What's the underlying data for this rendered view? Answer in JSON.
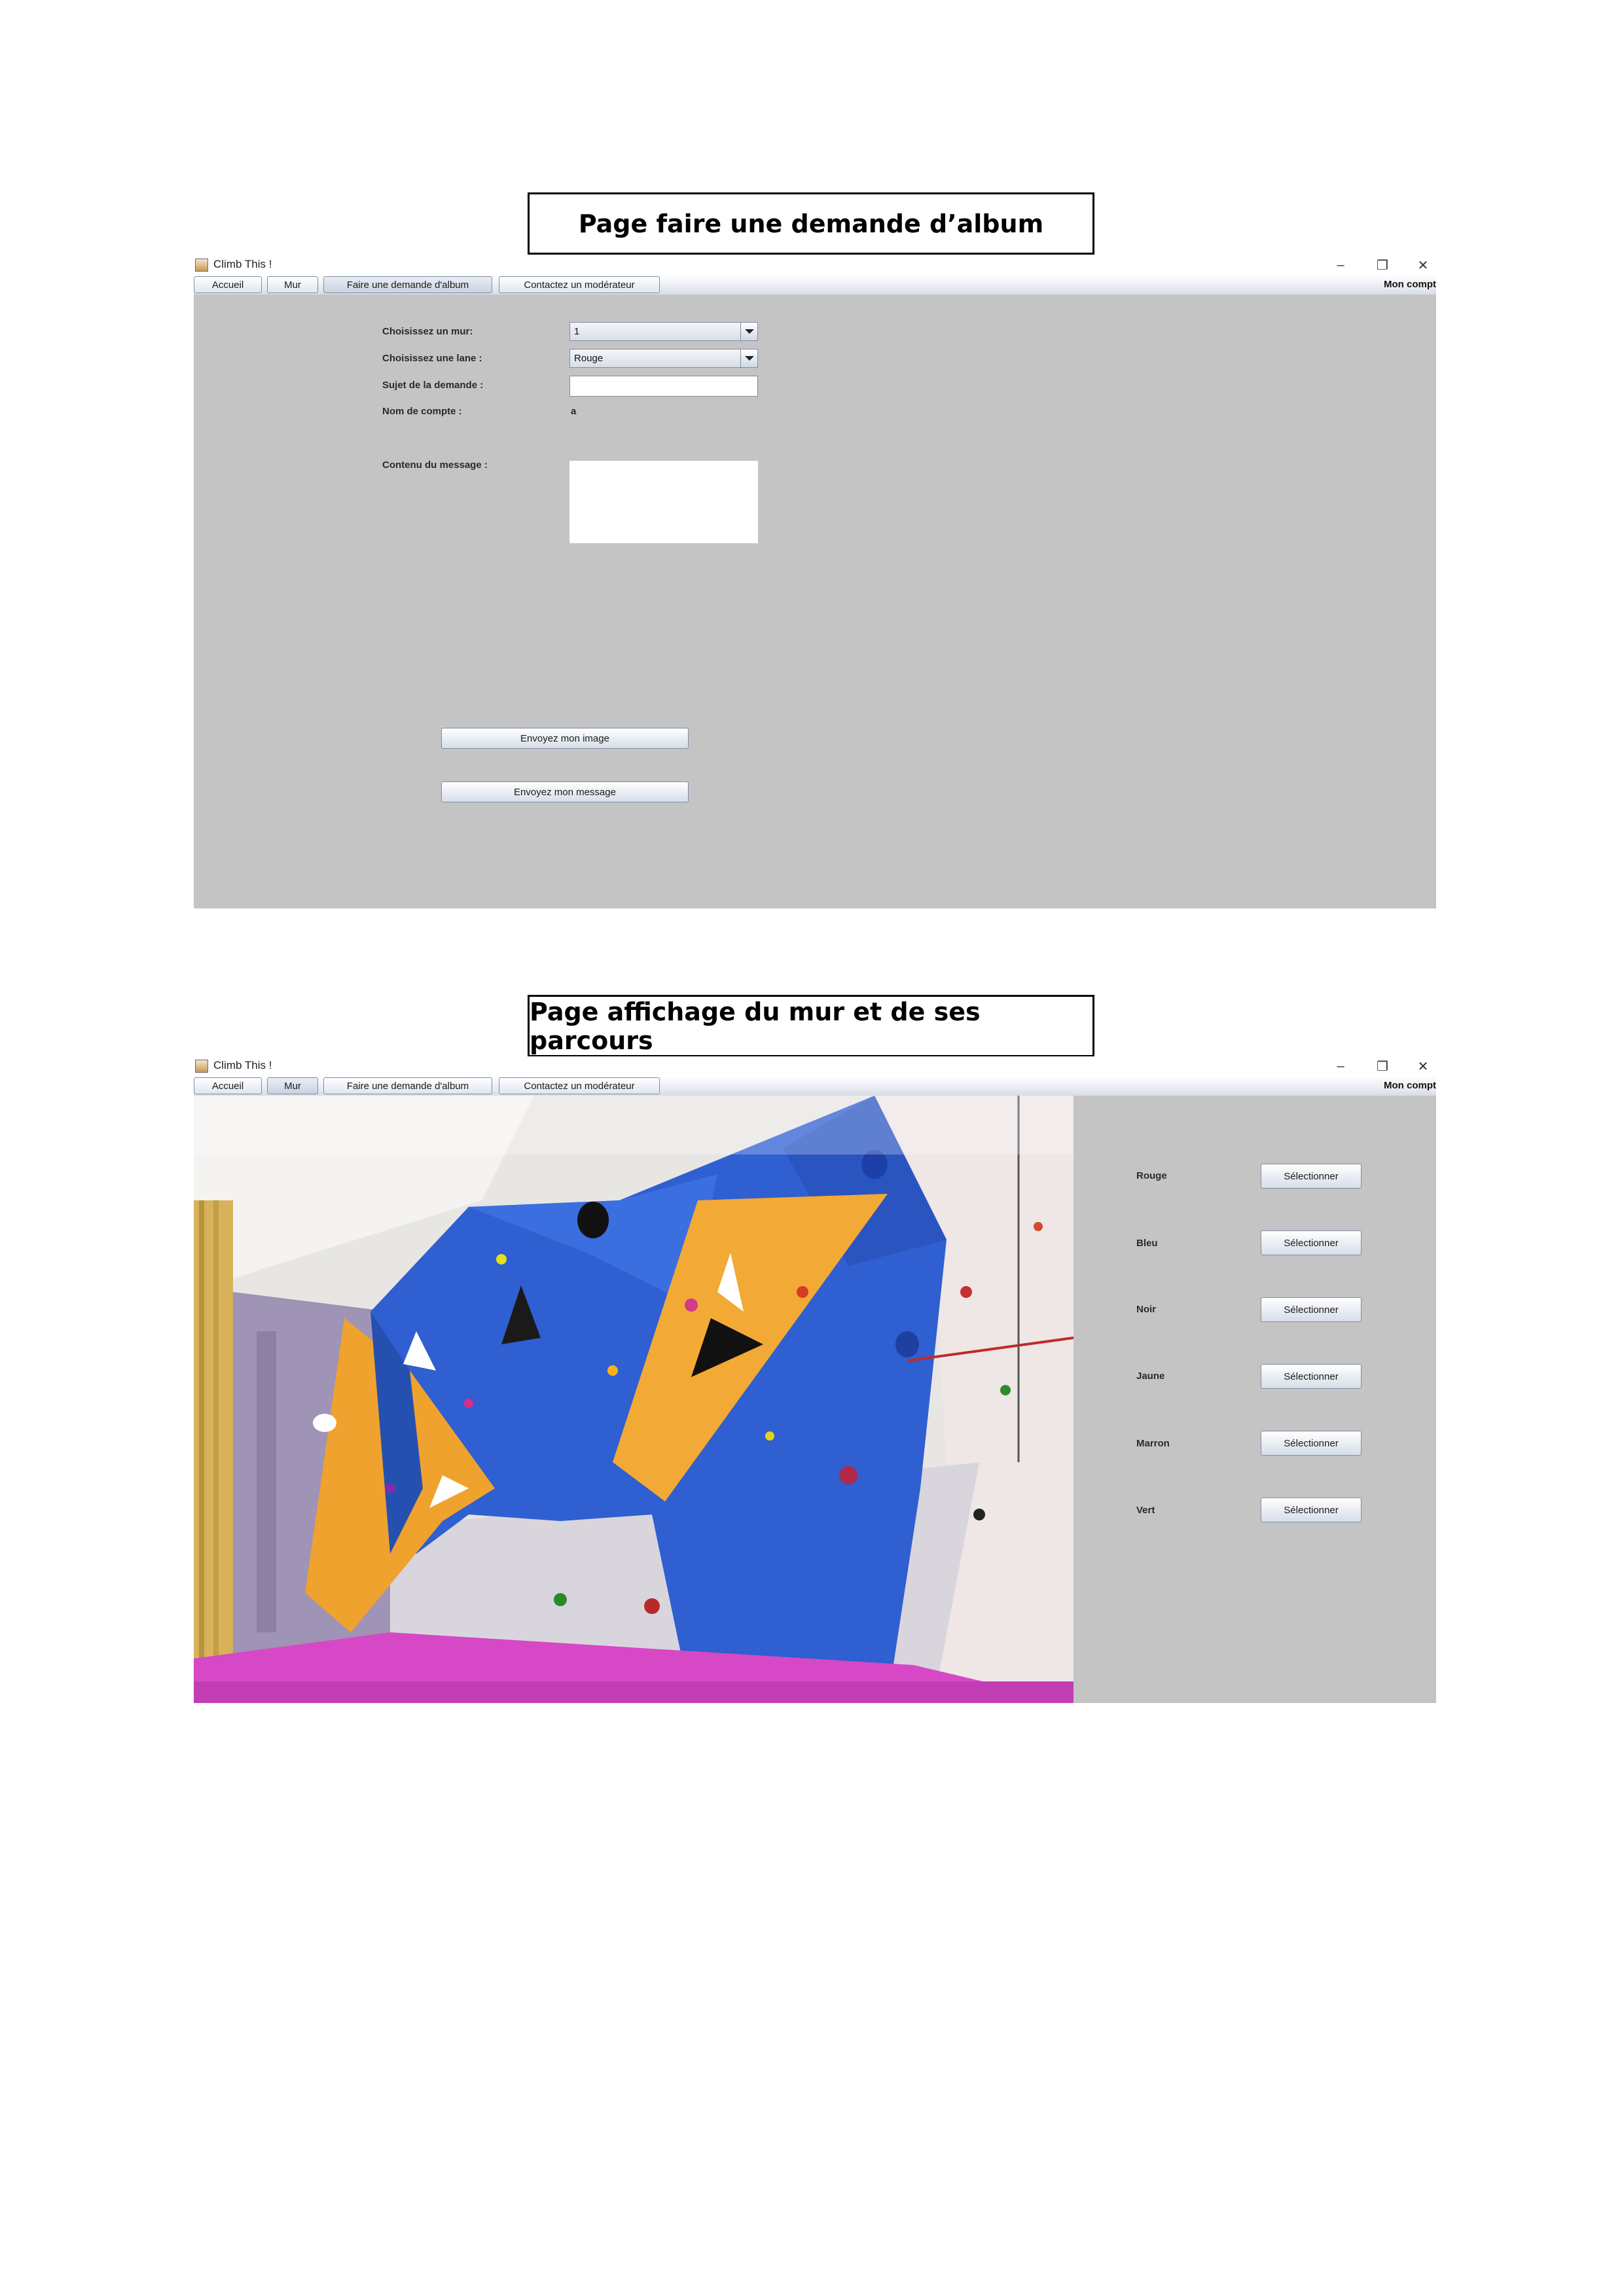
{
  "section1": {
    "caption": "Page faire une demande d’album",
    "window": {
      "title": "Climb This !",
      "menu": [
        "Accueil",
        "Mur",
        "Faire une demande d'album",
        "Contactez un modérateur"
      ],
      "account": "Mon compt"
    },
    "form": {
      "wall_label": "Choisissez un mur:",
      "wall_value": "1",
      "lane_label": "Choisissez une lane :",
      "lane_value": "Rouge",
      "subject_label": "Sujet de la demande :",
      "subject_value": "",
      "account_label": "Nom de compte :",
      "account_value": "a",
      "message_label": "Contenu du message :",
      "message_value": "",
      "send_image": "Envoyez mon image",
      "send_message": "Envoyez mon message"
    }
  },
  "section2": {
    "caption": "Page affichage du mur et de ses parcours",
    "window": {
      "title": "Climb This !",
      "menu": [
        "Accueil",
        "Mur",
        "Faire une demande d'album",
        "Contactez un modérateur"
      ],
      "account": "Mon compt"
    },
    "lanes": [
      {
        "name": "Rouge",
        "button": "Sélectionner"
      },
      {
        "name": "Bleu",
        "button": "Sélectionner"
      },
      {
        "name": "Noir",
        "button": "Sélectionner"
      },
      {
        "name": "Jaune",
        "button": "Sélectionner"
      },
      {
        "name": "Marron",
        "button": "Sélectionner"
      },
      {
        "name": "Vert",
        "button": "Sélectionner"
      }
    ]
  }
}
